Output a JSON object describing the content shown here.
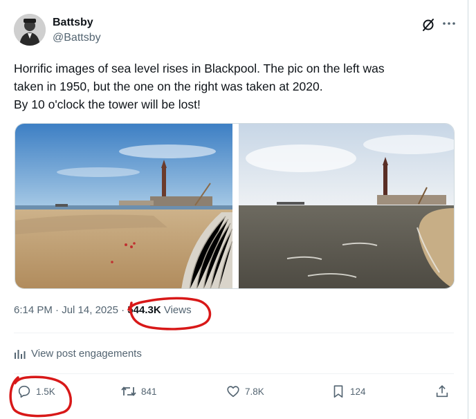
{
  "author": {
    "display_name": "Battsby",
    "handle": "@Battsby"
  },
  "icons": {
    "grok": "grok-icon",
    "more": "more-icon",
    "analytics": "analytics-icon",
    "reply": "reply-icon",
    "repost": "repost-icon",
    "like": "like-icon",
    "bookmark": "bookmark-icon",
    "share": "share-icon"
  },
  "post": {
    "text_lines": [
      "Horrific images of sea level rises in Blackpool. The pic on the left was",
      "taken in 1950, but the one on the right was taken at 2020.",
      "By 10 o'clock the tower will be lost!"
    ]
  },
  "meta": {
    "time": "6:14 PM",
    "separator": " · ",
    "date": "Jul 14, 2025",
    "views_count": "544.3K",
    "views_label": " Views"
  },
  "engagements_label": "View post engagements",
  "actions": {
    "replies": "1.5K",
    "reposts": "841",
    "likes": "7.8K",
    "bookmarks": "124"
  },
  "colors": {
    "text_primary": "#0f1419",
    "text_secondary": "#536471",
    "divider": "#eff3f4",
    "annotation_red": "#d81818"
  }
}
